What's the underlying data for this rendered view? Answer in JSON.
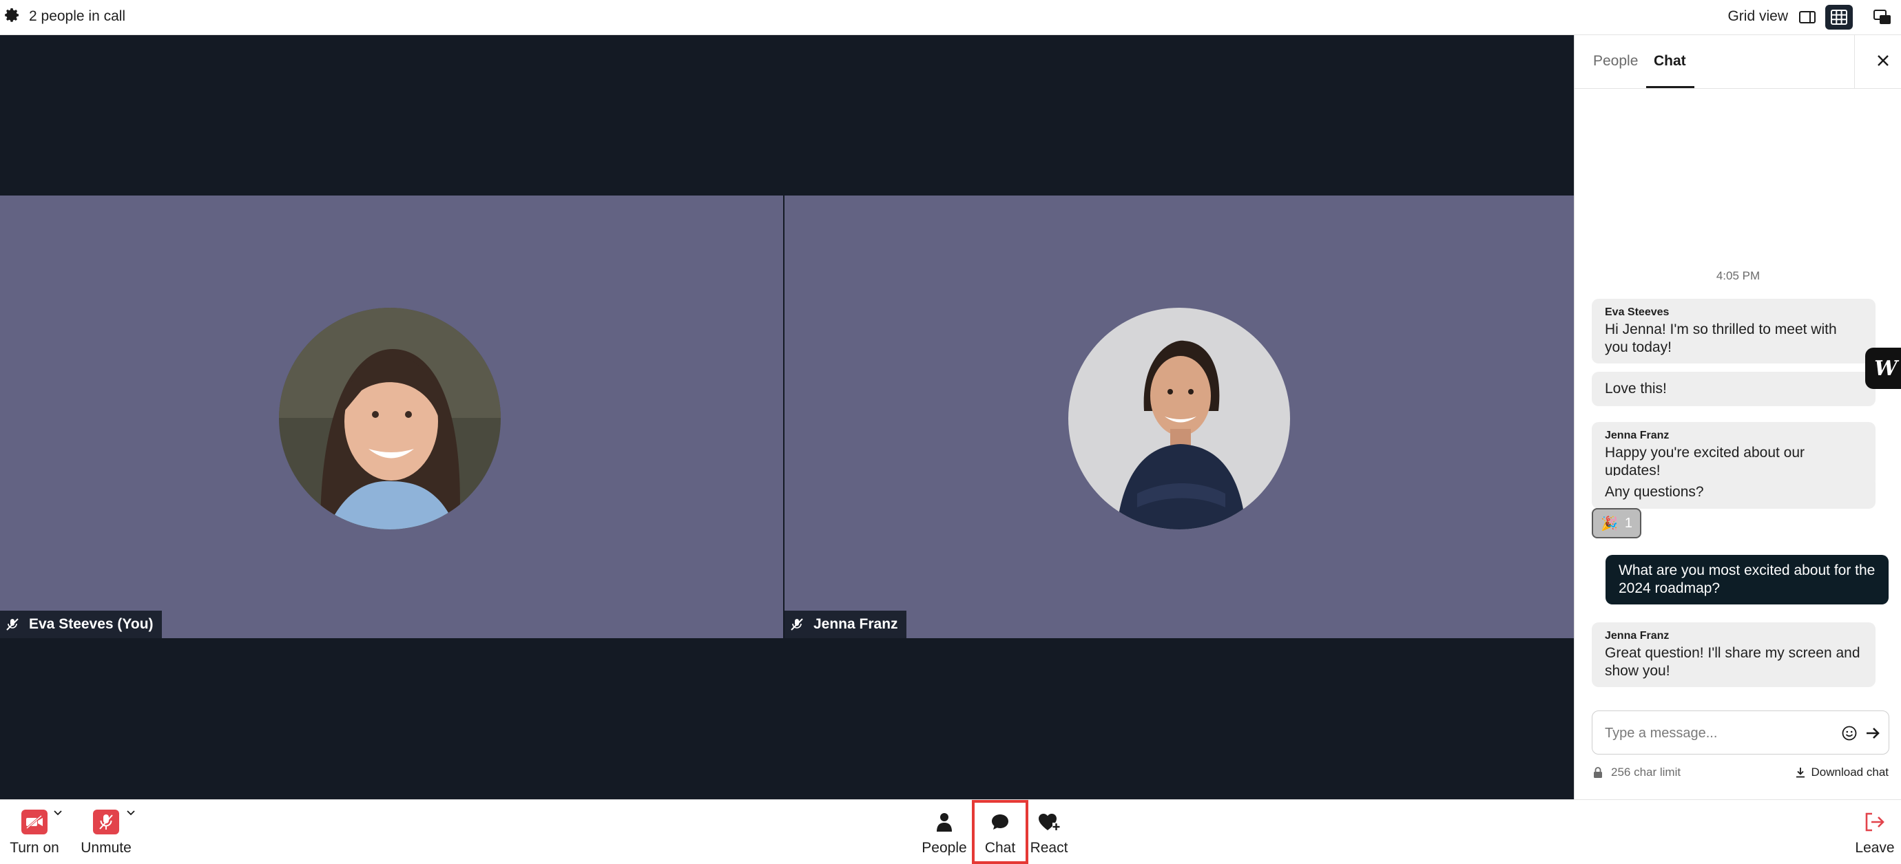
{
  "topbar": {
    "people_count": "2 people in call",
    "view_label": "Grid view"
  },
  "participants": [
    {
      "name": "Eva Steeves (You)",
      "muted": true
    },
    {
      "name": "Jenna Franz",
      "muted": true
    }
  ],
  "panel": {
    "tabs": [
      "People",
      "Chat"
    ],
    "active_tab": "Chat",
    "timestamp": "4:05 PM",
    "messages": [
      {
        "sender": "Eva Steeves",
        "text": "Hi Jenna! I'm so thrilled to meet with you today!"
      },
      {
        "sender": "",
        "text": "Love this!"
      },
      {
        "sender": "Jenna Franz",
        "text": "Happy you're excited about our updates!"
      },
      {
        "sender": "",
        "text": "Any questions?"
      },
      {
        "sender": "",
        "text": "What are you most excited about for the 2024 roadmap?",
        "mine": true
      },
      {
        "sender": "Jenna Franz",
        "text": "Great question! I'll share my screen and show you!"
      }
    ],
    "reaction": {
      "emoji": "🎉",
      "count": "1"
    },
    "compose_placeholder": "Type a message...",
    "char_limit": "256 char limit",
    "download_label": "Download chat"
  },
  "bottombar": {
    "camera_label": "Turn on",
    "mic_label": "Unmute",
    "people_label": "People",
    "chat_label": "Chat",
    "react_label": "React",
    "leave_label": "Leave"
  },
  "colors": {
    "stage": "#141a24",
    "tile": "#636383",
    "accent_red": "#e2434b",
    "my_bubble": "#0d1d26"
  }
}
